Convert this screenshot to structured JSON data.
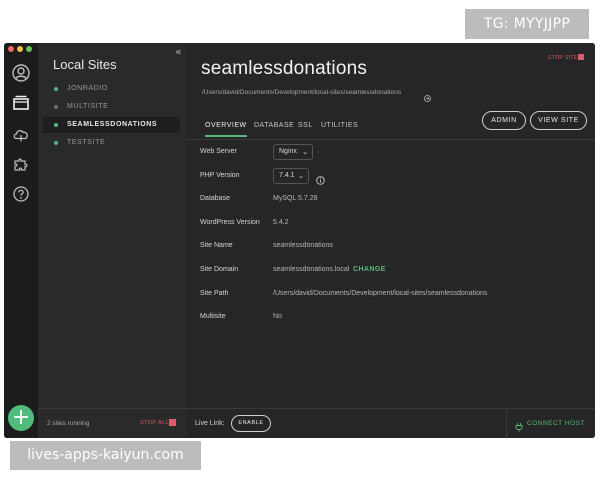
{
  "watermarks": {
    "top": "TG: MYYJJPP",
    "bottom": "lives-apps-kaiyun.com"
  },
  "rail": {
    "icons": [
      "user-icon",
      "sites-icon",
      "cloud-icon",
      "puzzle-icon",
      "help-icon"
    ],
    "add_label": "+"
  },
  "sites_panel": {
    "collapse_glyph": "«",
    "title": "Local Sites",
    "items": [
      {
        "label": "JONRADIO",
        "running": true
      },
      {
        "label": "MULTISITE",
        "running": false
      },
      {
        "label": "SEAMLESSDONATIONS",
        "running": true
      },
      {
        "label": "TESTSITE",
        "running": true
      }
    ],
    "footer": {
      "running_text": "2 sites running",
      "stop_all_label": "STOP ALL"
    }
  },
  "site": {
    "stop_site_label": "STOP SITE",
    "title": "seamlessdonations",
    "path": "/Users/david/Documents/Development/local-sites/seamlessdonations",
    "admin_label": "ADMIN",
    "view_site_label": "VIEW SITE",
    "tabs": [
      "OVERVIEW",
      "DATABASE",
      "SSL",
      "UTILITIES"
    ],
    "active_tab": "OVERVIEW"
  },
  "overview": {
    "web_server": {
      "label": "Web Server",
      "value": "Nginx"
    },
    "php_version": {
      "label": "PHP Version",
      "value": "7.4.1"
    },
    "database": {
      "label": "Database",
      "value": "MySQL 5.7.28"
    },
    "wordpress_version": {
      "label": "WordPress Version",
      "value": "5.4.2"
    },
    "site_name": {
      "label": "Site Name",
      "value": "seamlessdonations"
    },
    "site_domain": {
      "label": "Site Domain",
      "value": "seamlessdonations.local",
      "change_label": "CHANGE"
    },
    "site_path": {
      "label": "Site Path",
      "value": "/Users/david/Documents/Development/local-sites/seamlessdonations"
    },
    "multisite": {
      "label": "Multisite",
      "value": "No"
    }
  },
  "footer": {
    "live_link_label": "Live Link:",
    "enable_label": "ENABLE",
    "connect_host_label": "CONNECT HOST"
  },
  "colors": {
    "accent": "#51bb7b",
    "danger": "#e0596f",
    "background": "#262626"
  }
}
